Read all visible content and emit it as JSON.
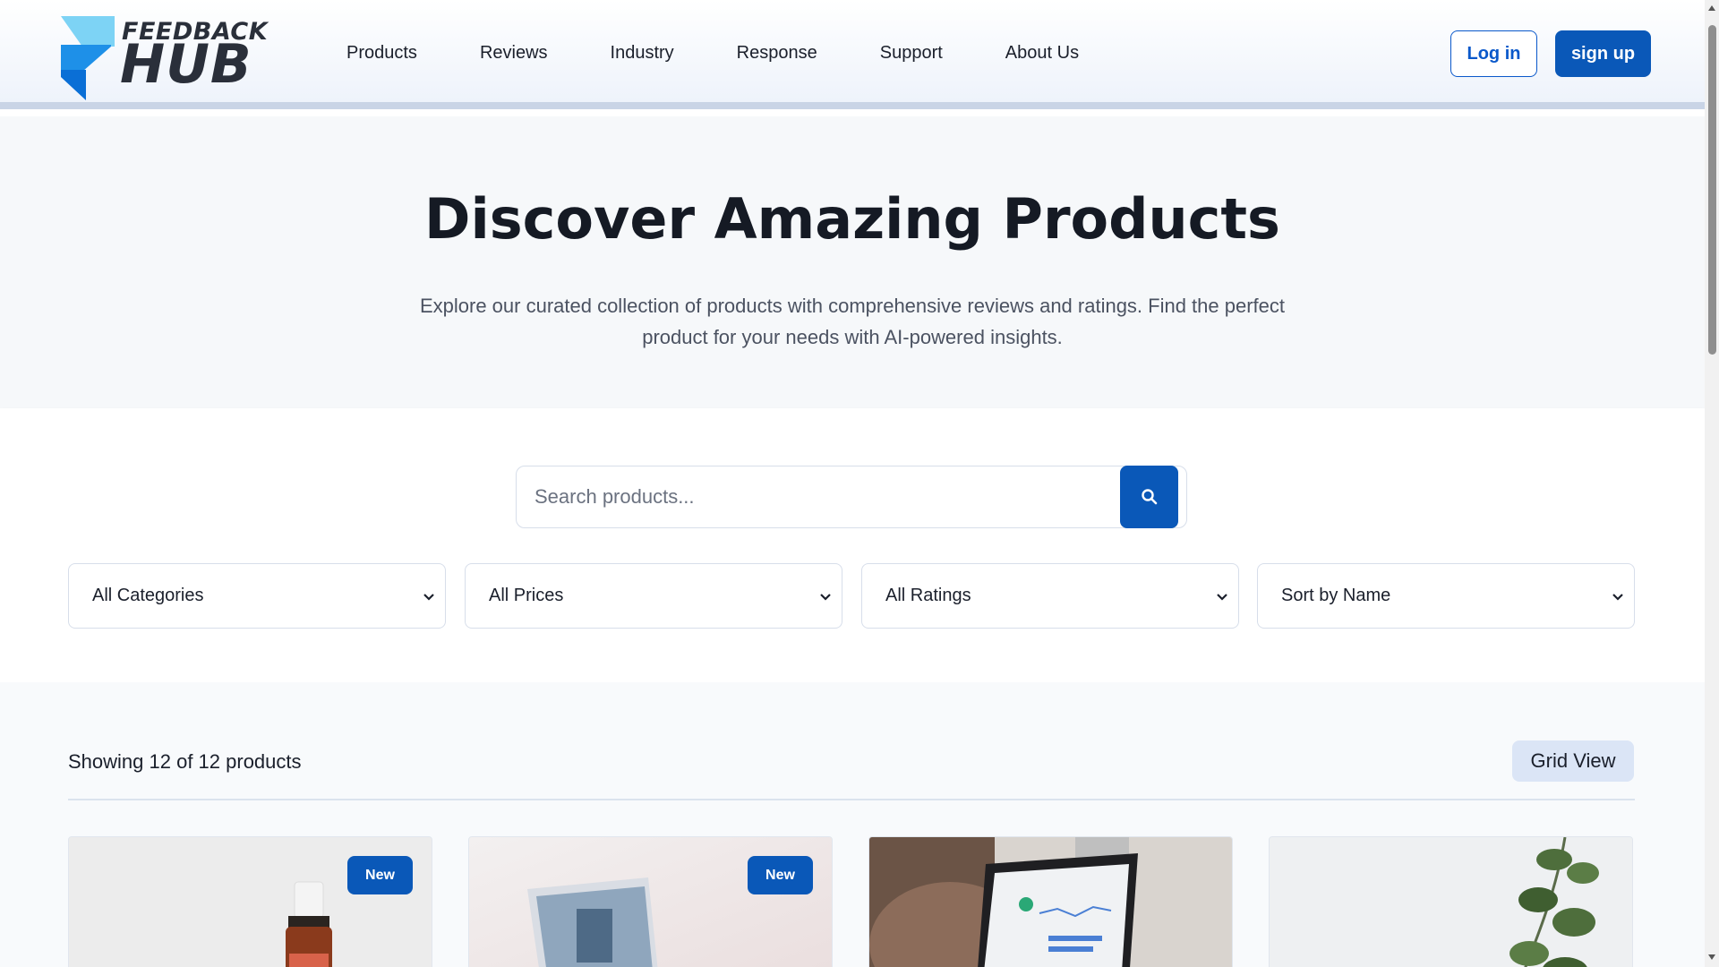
{
  "brand": {
    "line1": "FEEDBACK",
    "line2": "HUB",
    "primary_color": "#0a58b8",
    "logo_light": "#7dd3f5",
    "logo_dark": "#1e90e8"
  },
  "nav": {
    "items": [
      {
        "label": "Products"
      },
      {
        "label": "Reviews"
      },
      {
        "label": "Industry"
      },
      {
        "label": "Response"
      },
      {
        "label": "Support"
      },
      {
        "label": "About Us"
      }
    ]
  },
  "auth": {
    "login_label": "Log in",
    "signup_label": "sign up"
  },
  "hero": {
    "title": "Discover Amazing Products",
    "subtitle_line1": "Explore our curated collection of products with comprehensive reviews and ratings. Find the perfect",
    "subtitle_line2": "product for your needs with AI-powered insights."
  },
  "search": {
    "placeholder": "Search products...",
    "icon": "search-icon"
  },
  "filters": [
    {
      "value": "All Categories"
    },
    {
      "value": "All Prices"
    },
    {
      "value": "All Ratings"
    },
    {
      "value": "Sort by Name"
    }
  ],
  "listing": {
    "count_text": "Showing 12 of 12 products",
    "view_label": "Grid View",
    "cards": [
      {
        "image": "essential-oil-bottle",
        "badge": "New"
      },
      {
        "image": "laptop-blurred",
        "badge": "New"
      },
      {
        "image": "laptop-analytics-dashboard",
        "badge": ""
      },
      {
        "image": "eucalyptus-plant",
        "badge": ""
      }
    ]
  }
}
